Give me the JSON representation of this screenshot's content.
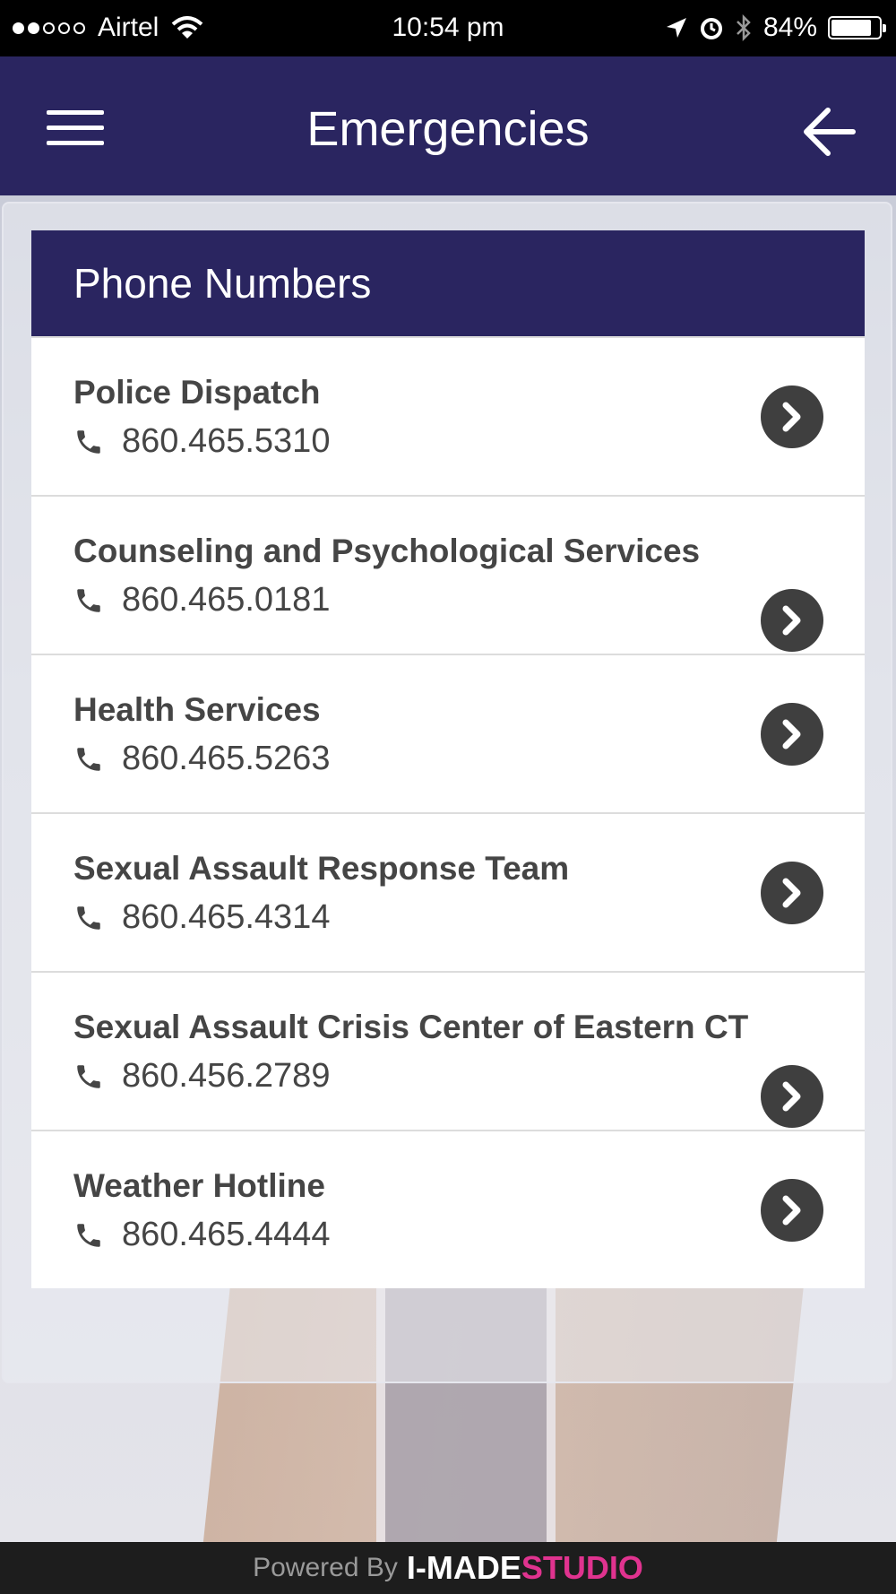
{
  "status_bar": {
    "carrier": "Airtel",
    "time": "10:54 pm",
    "battery": "84%",
    "battery_level": 0.84,
    "signal_bars_filled": 2,
    "signal_bars_total": 5
  },
  "header": {
    "title": "Emergencies",
    "menu_icon": "hamburger-icon",
    "back_icon": "arrow-left-icon"
  },
  "section": {
    "title": "Phone Numbers"
  },
  "contacts": [
    {
      "name": "Police Dispatch",
      "phone": "860.465.5310"
    },
    {
      "name": "Counseling and Psychological Services",
      "phone": "860.465.0181"
    },
    {
      "name": "Health Services",
      "phone": "860.465.5263"
    },
    {
      "name": "Sexual Assault Response Team",
      "phone": "860.465.4314"
    },
    {
      "name": "Sexual Assault Crisis Center of Eastern CT",
      "phone": "860.456.2789"
    },
    {
      "name": "Weather Hotline",
      "phone": "860.465.4444"
    }
  ],
  "footer": {
    "powered_by": "Powered By",
    "brand_main": "I-MADE",
    "brand_accent": "STUDIO"
  },
  "colors": {
    "primary": "#2a2560",
    "accent": "#e0338f",
    "chevron_bg": "#3f3f3f"
  }
}
